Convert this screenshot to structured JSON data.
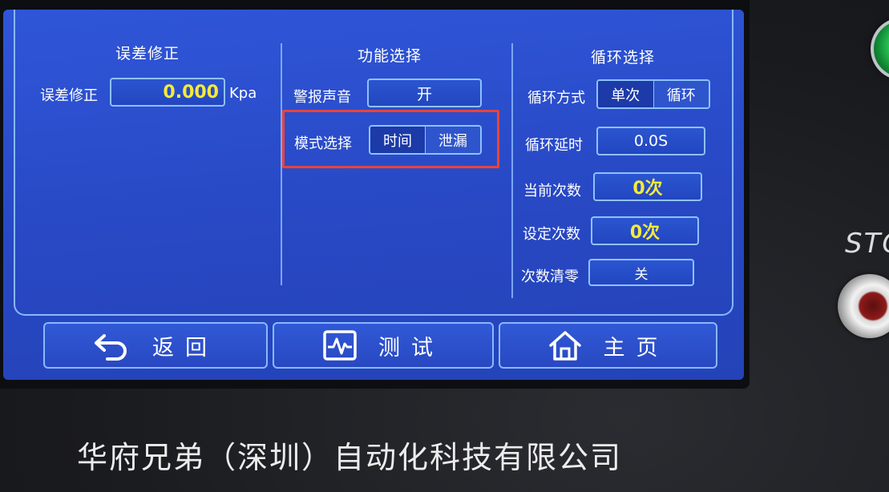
{
  "columns": {
    "error": {
      "title": "误差修正",
      "row_label": "误差修正",
      "value": "0.000",
      "unit": "Kpa"
    },
    "function": {
      "title": "功能选择",
      "alarm_label": "警报声音",
      "alarm_value": "开",
      "mode_label": "模式选择",
      "mode_options": [
        "时间",
        "泄漏"
      ]
    },
    "cycle": {
      "title": "循环选择",
      "mode_label": "循环方式",
      "mode_options": [
        "单次",
        "循环"
      ],
      "delay_label": "循环延时",
      "delay_value": "0.0S",
      "current_label": "当前次数",
      "current_value": "0次",
      "set_label": "设定次数",
      "set_value": "0次",
      "clear_label": "次数清零",
      "clear_value": "关"
    }
  },
  "nav": {
    "back": "返回",
    "test": "测试",
    "home": "主页"
  },
  "device": {
    "brand": "华府兄弟（深圳）自动化科技有限公司",
    "stop_text": "STO"
  },
  "colors": {
    "screen_bg": "#2a4cc8",
    "border": "#87b9ff",
    "value_yellow": "#f6ea3a",
    "highlight_red": "#e8443a"
  }
}
